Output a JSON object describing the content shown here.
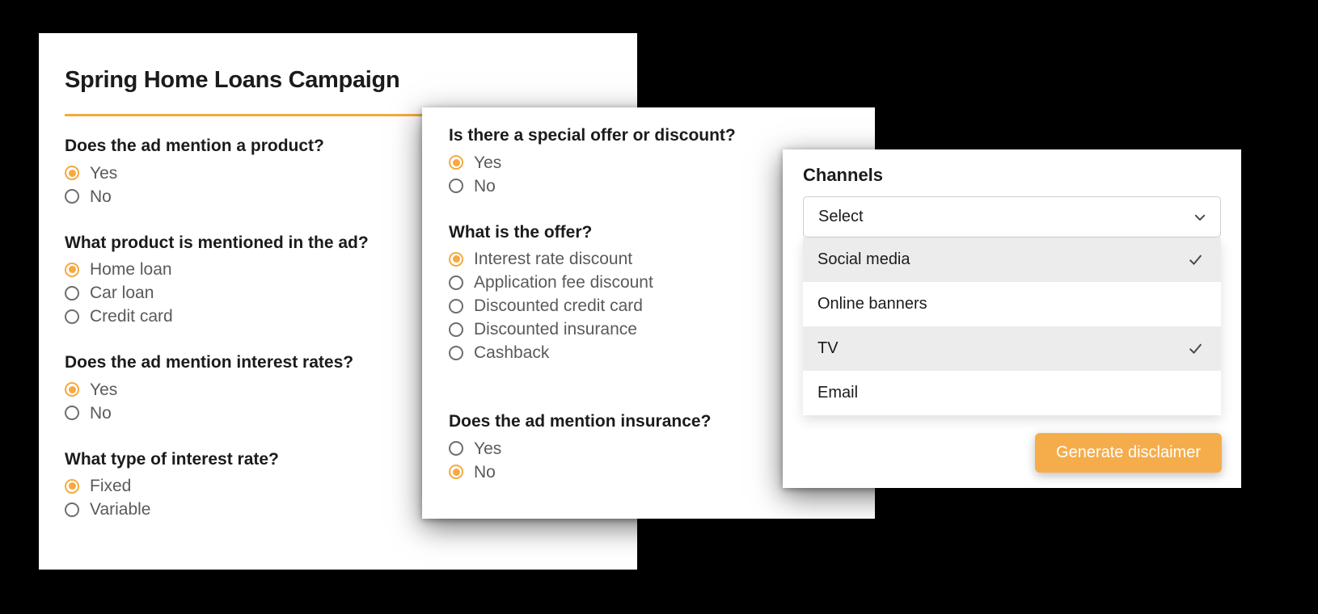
{
  "campaign_card": {
    "title": "Spring Home Loans Campaign",
    "questions": [
      {
        "label": "Does the ad mention a product?",
        "options": [
          {
            "label": "Yes",
            "selected": true
          },
          {
            "label": "No",
            "selected": false
          }
        ]
      },
      {
        "label": "What product is mentioned in the ad?",
        "options": [
          {
            "label": "Home loan",
            "selected": true
          },
          {
            "label": "Car loan",
            "selected": false
          },
          {
            "label": "Credit card",
            "selected": false
          }
        ]
      },
      {
        "label": "Does the ad mention interest rates?",
        "options": [
          {
            "label": "Yes",
            "selected": true
          },
          {
            "label": "No",
            "selected": false
          }
        ]
      },
      {
        "label": "What type of interest rate?",
        "options": [
          {
            "label": "Fixed",
            "selected": true
          },
          {
            "label": "Variable",
            "selected": false
          }
        ]
      }
    ]
  },
  "offer_card": {
    "questions": [
      {
        "label": "Is there a special offer or discount?",
        "options": [
          {
            "label": "Yes",
            "selected": true
          },
          {
            "label": "No",
            "selected": false
          }
        ]
      },
      {
        "label": "What is the offer?",
        "options": [
          {
            "label": "Interest rate discount",
            "selected": true
          },
          {
            "label": "Application fee discount",
            "selected": false
          },
          {
            "label": "Discounted credit card",
            "selected": false
          },
          {
            "label": "Discounted insurance",
            "selected": false
          },
          {
            "label": "Cashback",
            "selected": false
          }
        ]
      },
      {
        "label": "Does the ad mention insurance?",
        "options": [
          {
            "label": "Yes",
            "selected": false
          },
          {
            "label": "No",
            "selected": true
          }
        ]
      }
    ]
  },
  "channels_card": {
    "title": "Channels",
    "select": {
      "value": "Select",
      "icon": "chevron-down-icon"
    },
    "options": [
      {
        "label": "Social media",
        "checked": true
      },
      {
        "label": "Online banners",
        "checked": false
      },
      {
        "label": "TV",
        "checked": true
      },
      {
        "label": "Email",
        "checked": false
      }
    ],
    "check_icon": "check-icon",
    "generate_button": "Generate disclaimer"
  },
  "colors": {
    "accent": "#f5a93f",
    "button": "#f5ad4b",
    "card_bg": "#ffffff",
    "page_bg": "#000000",
    "row_alt": "#ececec",
    "label_text": "#1b1b1b",
    "option_text": "#5a5a5a"
  }
}
